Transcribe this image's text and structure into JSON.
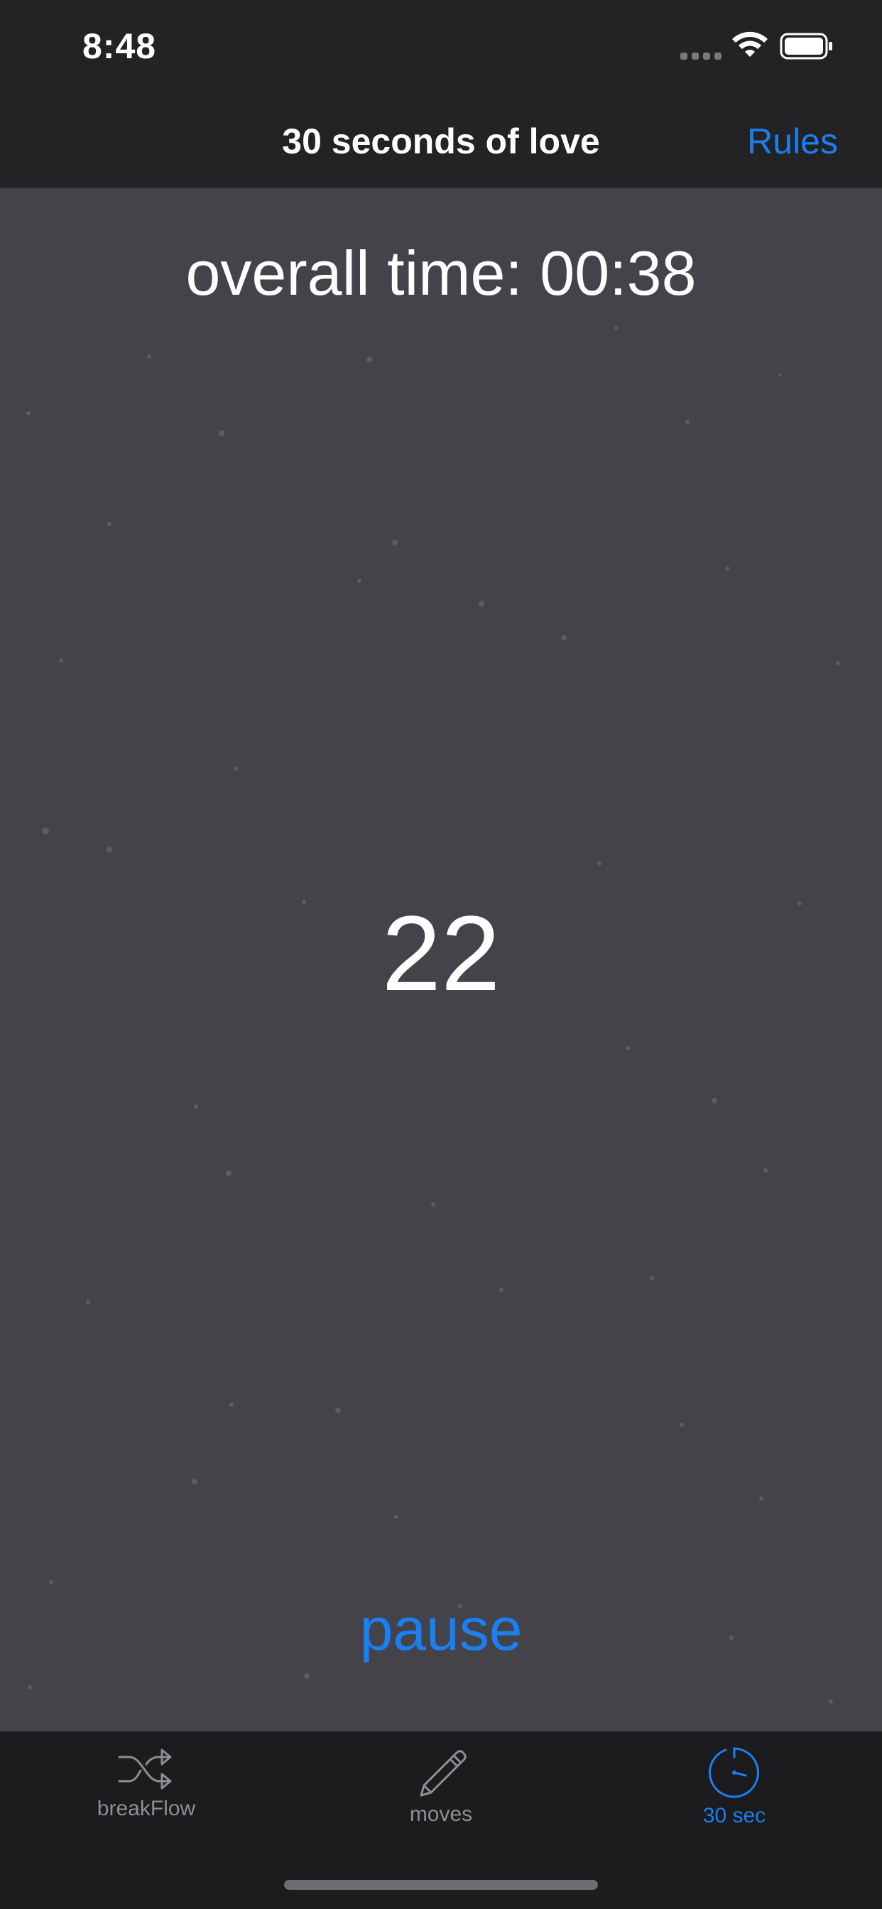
{
  "status_bar": {
    "time": "8:48",
    "icons": [
      "signal-icon",
      "wifi-icon",
      "battery-icon"
    ]
  },
  "nav": {
    "title": "30 seconds of love",
    "rules_label": "Rules"
  },
  "timer": {
    "overall_time": "overall time: 00:38",
    "countdown": "22",
    "pause_label": "pause"
  },
  "tabs": [
    {
      "label": "breakFlow",
      "icon": "shuffle-icon",
      "active": false
    },
    {
      "label": "moves",
      "icon": "pencil-icon",
      "active": false
    },
    {
      "label": "30 sec",
      "icon": "timer-icon",
      "active": true
    }
  ],
  "colors": {
    "accent": "#1a7ff0",
    "main_background": "#434349",
    "bar_background": "#232325",
    "tab_inactive": "#8e8e93"
  }
}
